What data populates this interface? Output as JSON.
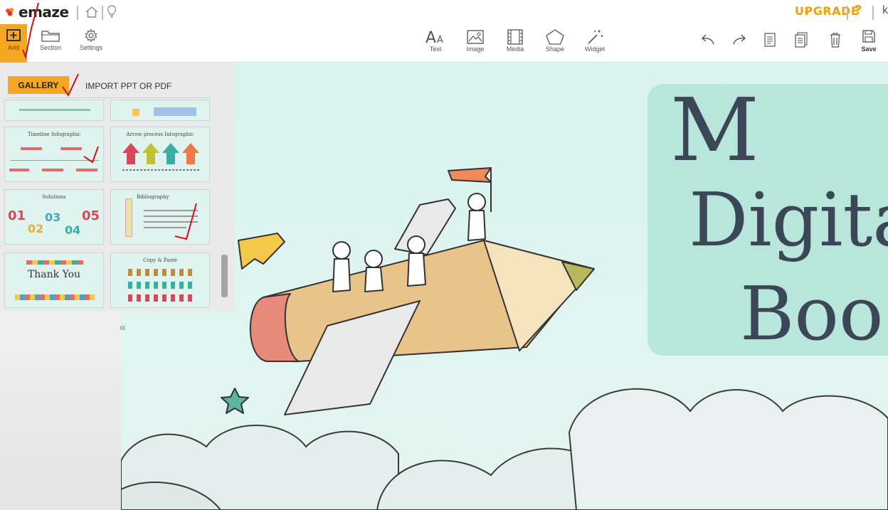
{
  "app": {
    "logo_text": "emaze",
    "upgrade_label": "UPGRADE",
    "help_label": "?",
    "user_initial": "k"
  },
  "toolbar": {
    "left": [
      {
        "label": "Add",
        "icon": "add-icon"
      },
      {
        "label": "Section",
        "icon": "folder-icon"
      },
      {
        "label": "Settings",
        "icon": "gear-icon"
      }
    ],
    "center": [
      {
        "label": "Text",
        "icon": "text-icon"
      },
      {
        "label": "Image",
        "icon": "image-icon"
      },
      {
        "label": "Media",
        "icon": "film-icon"
      },
      {
        "label": "Shape",
        "icon": "pentagon-icon"
      },
      {
        "label": "Widget",
        "icon": "magic-wand-icon"
      }
    ],
    "right": [
      {
        "label": "",
        "icon": "undo-icon"
      },
      {
        "label": "",
        "icon": "redo-icon"
      },
      {
        "label": "",
        "icon": "notes-icon"
      },
      {
        "label": "",
        "icon": "duplicate-icon"
      },
      {
        "label": "",
        "icon": "trash-icon"
      },
      {
        "label": "Save",
        "icon": "save-icon"
      }
    ],
    "accent_color": "#f5a623"
  },
  "panel": {
    "tabs": [
      {
        "label": "GALLERY",
        "active": true
      },
      {
        "label": "IMPORT PPT OR PDF",
        "active": false
      }
    ],
    "thumbnails": [
      {
        "title": ""
      },
      {
        "title": ""
      },
      {
        "title": "Timeline Infographic"
      },
      {
        "title": "Arrow process Infographic"
      },
      {
        "title": "Solutions"
      },
      {
        "title": "Bibliography"
      },
      {
        "title": "Thank You"
      },
      {
        "title": "Copy & Paste"
      }
    ],
    "collapse_glyph": "«"
  },
  "slide": {
    "title_lines": [
      "M",
      "Digita",
      "Boo"
    ],
    "title_color": "#3b4656",
    "title_box_color": "#b8e6db",
    "background_color": "#dcf4ef"
  }
}
